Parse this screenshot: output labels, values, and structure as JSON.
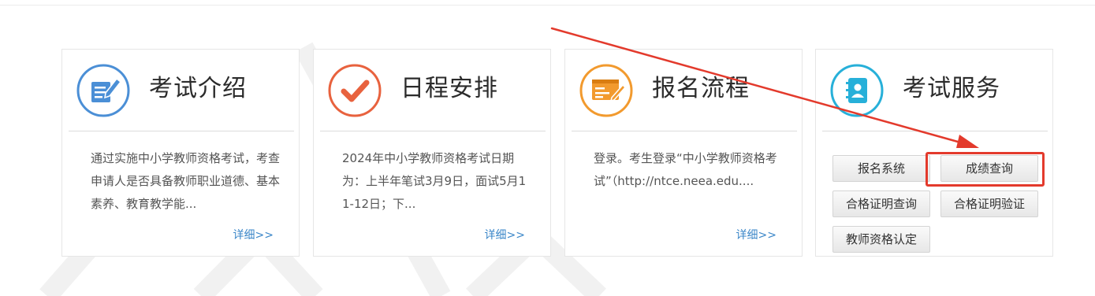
{
  "cards": [
    {
      "title": "考试介绍",
      "icon": "document-edit-icon",
      "accent": "#4b8fd6",
      "description": "通过实施中小学教师资格考试，考查申请人是否具备教师职业道德、基本素养、教育教学能...",
      "more_label": "详细>>"
    },
    {
      "title": "日程安排",
      "icon": "checkmark-icon",
      "accent": "#e8623e",
      "description": "2024年中小学教师资格考试日期为：上半年笔试3月9日，面试5月11-12日；下...",
      "more_label": "详细>>"
    },
    {
      "title": "报名流程",
      "icon": "web-form-icon",
      "accent": "#f29a2e",
      "description": "登录。考生登录“中小学教师资格考试”（http://ntce.neea.edu....",
      "more_label": "详细>>"
    },
    {
      "title": "考试服务",
      "icon": "contact-book-icon",
      "accent": "#27b0d9"
    }
  ],
  "services": [
    {
      "label": "报名系统"
    },
    {
      "label": "成绩查询"
    },
    {
      "label": "合格证明查询"
    },
    {
      "label": "合格证明验证"
    },
    {
      "label": "教师资格认定"
    }
  ],
  "annotation": {
    "color": "#e33a2c",
    "target": "成绩查询"
  },
  "colors": {
    "link": "#3a86c8",
    "border": "#e6e6e6"
  }
}
